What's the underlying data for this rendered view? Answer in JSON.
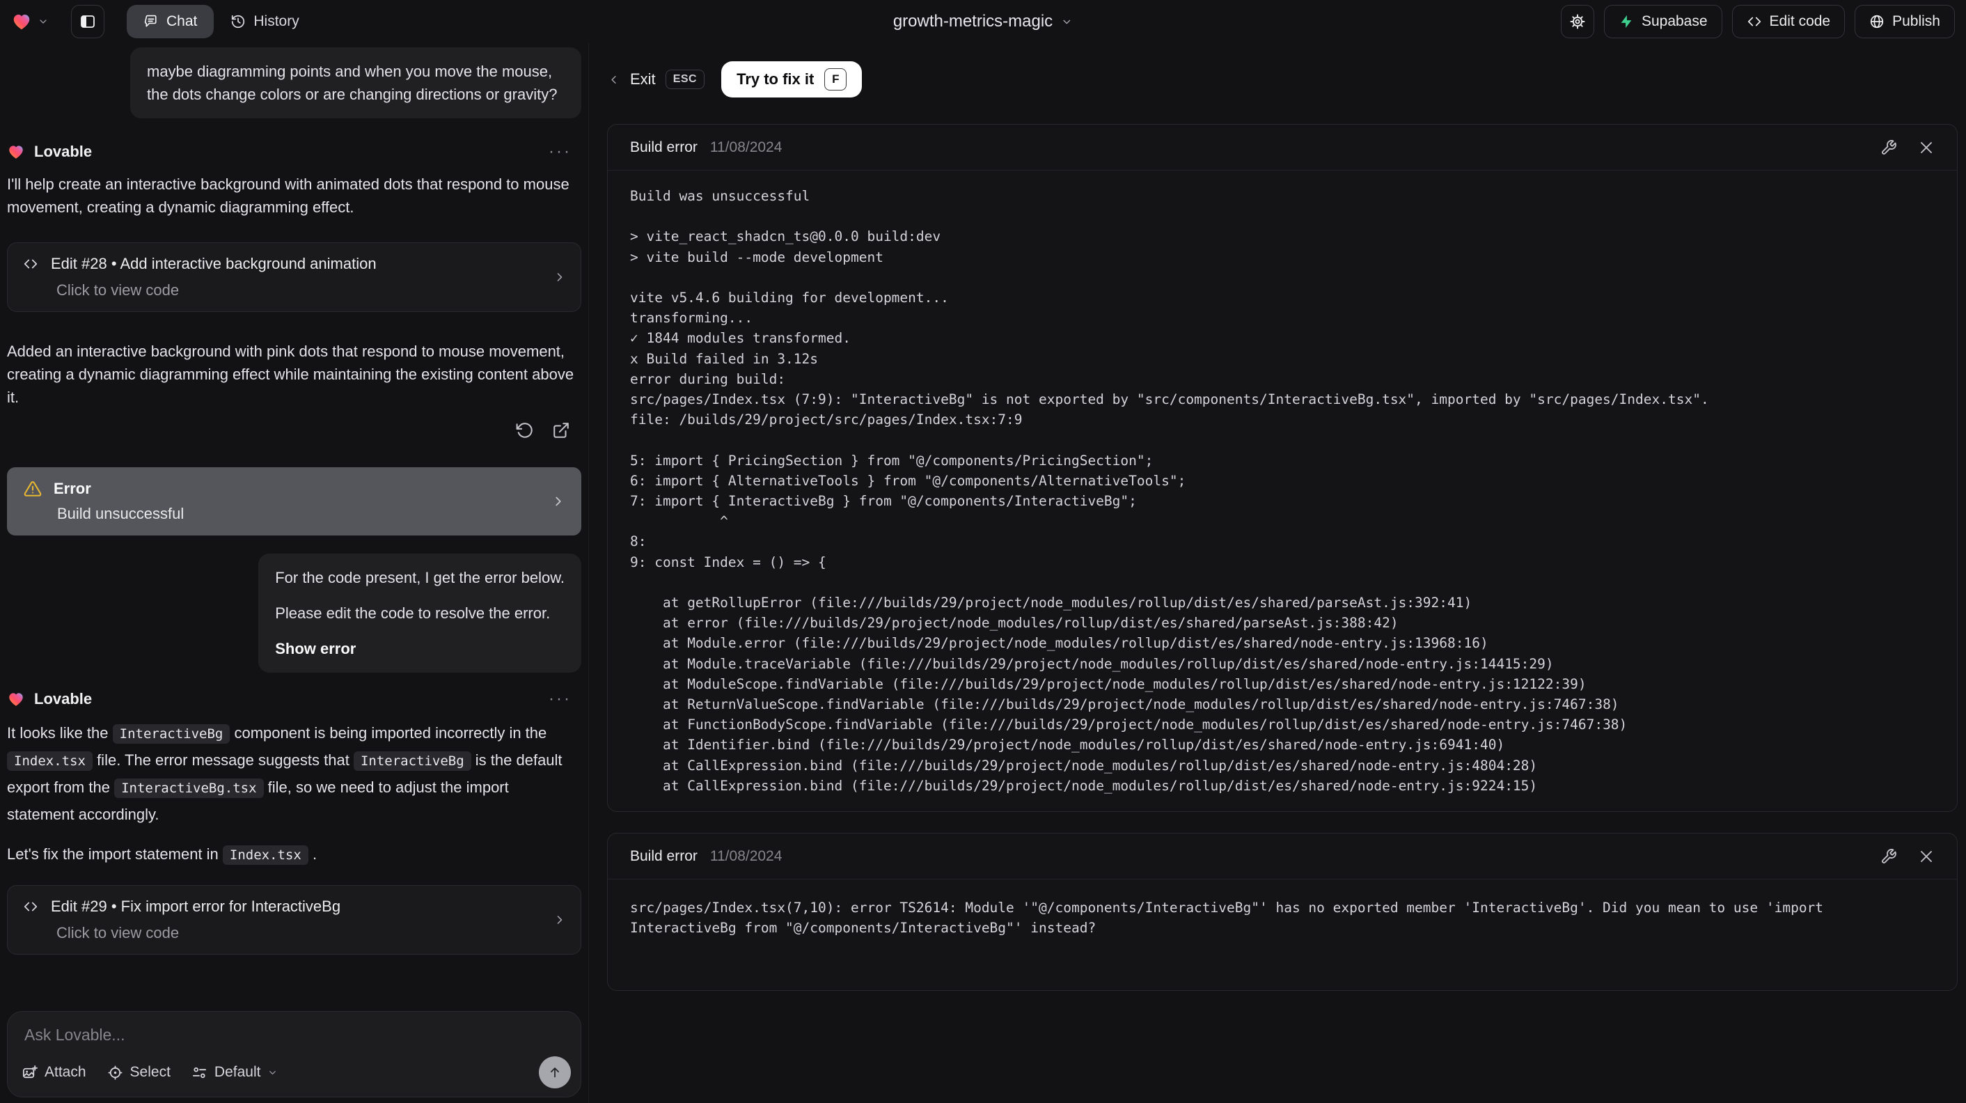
{
  "topbar": {
    "tabs": {
      "chat": "Chat",
      "history": "History"
    },
    "project_title": "growth-metrics-magic",
    "actions": {
      "supabase": "Supabase",
      "edit_code": "Edit code",
      "publish": "Publish"
    }
  },
  "chat": {
    "assistant_name": "Lovable",
    "user_message_1": "maybe diagramming points and when you move the mouse, the dots change colors or are changing directions or gravity?",
    "assistant_intro": "I'll help create an interactive background with animated dots that respond to mouse movement, creating a dynamic diagramming effect.",
    "edit_28": {
      "title": "Edit #28 • Add interactive background animation",
      "subtitle": "Click to view code"
    },
    "assistant_result": "Added an interactive background with pink dots that respond to mouse movement, creating a dynamic diagramming effect while maintaining the existing content above it.",
    "error_card": {
      "title": "Error",
      "subtitle": "Build unsuccessful"
    },
    "user_message_2": {
      "line1": "For the code present, I get the error below.",
      "line2": "Please edit the code to resolve the error.",
      "action": "Show error"
    },
    "assistant_fix": {
      "segments": [
        {
          "type": "text",
          "value": "It looks like the "
        },
        {
          "type": "code",
          "value": "InteractiveBg"
        },
        {
          "type": "text",
          "value": " component is being imported incorrectly in the "
        },
        {
          "type": "code",
          "value": "Index.tsx"
        },
        {
          "type": "text",
          "value": " file. The error message suggests that "
        },
        {
          "type": "code",
          "value": "InteractiveBg"
        },
        {
          "type": "text",
          "value": " is the default export from the "
        },
        {
          "type": "code",
          "value": "InteractiveBg.tsx"
        },
        {
          "type": "text",
          "value": " file, so we need to adjust the import statement accordingly."
        }
      ],
      "line2_segments": [
        {
          "type": "text",
          "value": "Let's fix the import statement in "
        },
        {
          "type": "code",
          "value": "Index.tsx"
        },
        {
          "type": "text",
          "value": " ."
        }
      ]
    },
    "edit_29": {
      "title": "Edit #29 • Fix import error for InteractiveBg",
      "subtitle": "Click to view code"
    },
    "composer": {
      "placeholder": "Ask Lovable...",
      "attach": "Attach",
      "select": "Select",
      "mode": "Default"
    }
  },
  "error_view": {
    "exit_label": "Exit",
    "esc_key": "ESC",
    "fix_label": "Try to fix it",
    "fix_key": "F",
    "panel_1": {
      "title": "Build error",
      "date": "11/08/2024",
      "log": "Build was unsuccessful\n\n> vite_react_shadcn_ts@0.0.0 build:dev\n> vite build --mode development\n\nvite v5.4.6 building for development...\ntransforming...\n✓ 1844 modules transformed.\nx Build failed in 3.12s\nerror during build:\nsrc/pages/Index.tsx (7:9): \"InteractiveBg\" is not exported by \"src/components/InteractiveBg.tsx\", imported by \"src/pages/Index.tsx\".\nfile: /builds/29/project/src/pages/Index.tsx:7:9\n\n5: import { PricingSection } from \"@/components/PricingSection\";\n6: import { AlternativeTools } from \"@/components/AlternativeTools\";\n7: import { InteractiveBg } from \"@/components/InteractiveBg\";\n           ^\n8:\n9: const Index = () => {\n\n    at getRollupError (file:///builds/29/project/node_modules/rollup/dist/es/shared/parseAst.js:392:41)\n    at error (file:///builds/29/project/node_modules/rollup/dist/es/shared/parseAst.js:388:42)\n    at Module.error (file:///builds/29/project/node_modules/rollup/dist/es/shared/node-entry.js:13968:16)\n    at Module.traceVariable (file:///builds/29/project/node_modules/rollup/dist/es/shared/node-entry.js:14415:29)\n    at ModuleScope.findVariable (file:///builds/29/project/node_modules/rollup/dist/es/shared/node-entry.js:12122:39)\n    at ReturnValueScope.findVariable (file:///builds/29/project/node_modules/rollup/dist/es/shared/node-entry.js:7467:38)\n    at FunctionBodyScope.findVariable (file:///builds/29/project/node_modules/rollup/dist/es/shared/node-entry.js:7467:38)\n    at Identifier.bind (file:///builds/29/project/node_modules/rollup/dist/es/shared/node-entry.js:6941:40)\n    at CallExpression.bind (file:///builds/29/project/node_modules/rollup/dist/es/shared/node-entry.js:4804:28)\n    at CallExpression.bind (file:///builds/29/project/node_modules/rollup/dist/es/shared/node-entry.js:9224:15)"
    },
    "panel_2": {
      "title": "Build error",
      "date": "11/08/2024",
      "log": "src/pages/Index.tsx(7,10): error TS2614: Module '\"@/components/InteractiveBg\"' has no exported member 'InteractiveBg'. Did you mean to use 'import\nInteractiveBg from \"@/components/InteractiveBg\"' instead?"
    }
  },
  "colors": {
    "supabase_green": "#3ecf8e",
    "warning_amber": "#e8b931",
    "fix_button_bg": "#ffffff",
    "error_card_bg": "#55565c"
  }
}
